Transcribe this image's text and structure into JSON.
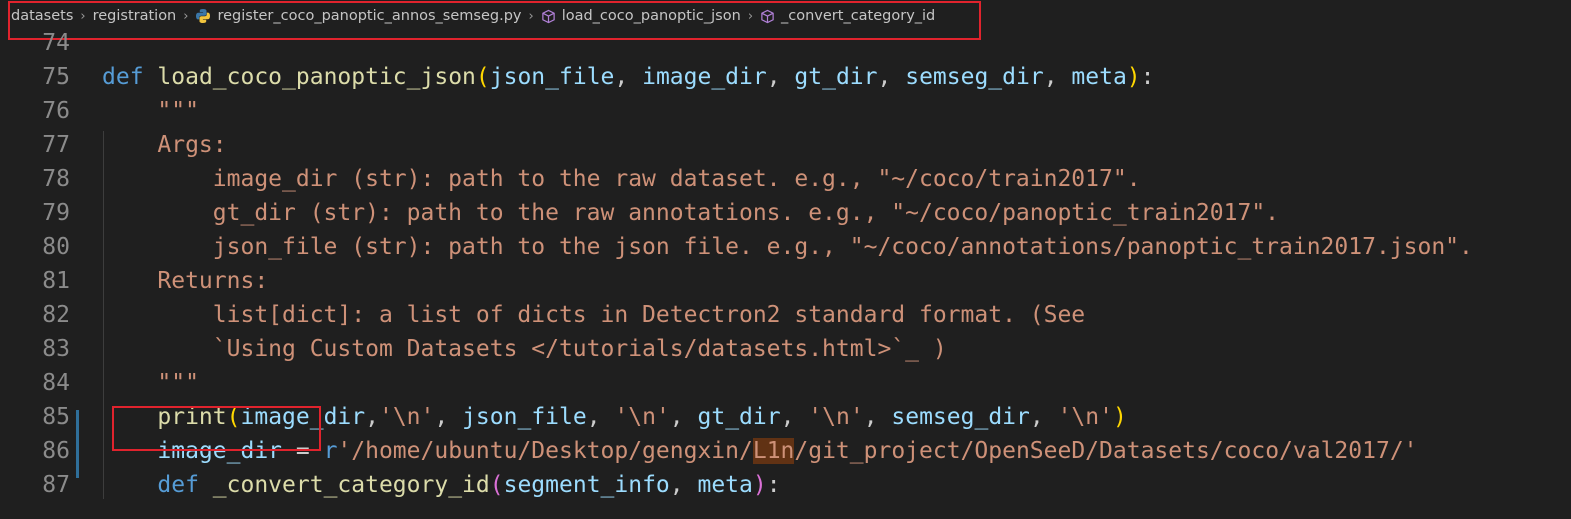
{
  "breadcrumb": {
    "items": [
      {
        "label": "datasets"
      },
      {
        "label": "registration"
      },
      {
        "label": "register_coco_panoptic_annos_semseg.py",
        "icon": "python-file-icon"
      },
      {
        "label": "load_coco_panoptic_json",
        "icon": "cube-symbol-icon"
      },
      {
        "label": "_convert_category_id",
        "icon": "cube-symbol-icon"
      }
    ]
  },
  "editor": {
    "lines": [
      {
        "num": "74",
        "text": ""
      },
      {
        "num": "75",
        "text": "def load_coco_panoptic_json(json_file, image_dir, gt_dir, semseg_dir, meta):"
      },
      {
        "num": "76",
        "text": "    \"\"\""
      },
      {
        "num": "77",
        "text": "    Args:"
      },
      {
        "num": "78",
        "text": "        image_dir (str): path to the raw dataset. e.g., \"~/coco/train2017\"."
      },
      {
        "num": "79",
        "text": "        gt_dir (str): path to the raw annotations. e.g., \"~/coco/panoptic_train2017\"."
      },
      {
        "num": "80",
        "text": "        json_file (str): path to the json file. e.g., \"~/coco/annotations/panoptic_train2017.json\"."
      },
      {
        "num": "81",
        "text": "    Returns:"
      },
      {
        "num": "82",
        "text": "        list[dict]: a list of dicts in Detectron2 standard format. (See"
      },
      {
        "num": "83",
        "text": "        `Using Custom Datasets </tutorials/datasets.html>`_ )"
      },
      {
        "num": "84",
        "text": "    \"\"\""
      },
      {
        "num": "85",
        "text": "    print(image_dir,'\\n', json_file, '\\n', gt_dir, '\\n', semseg_dir, '\\n')"
      },
      {
        "num": "86",
        "text": "    image_dir = r'/home/ubuntu/Desktop/gengxin/L1n/git_project/OpenSeeD/Datasets/coco/val2017/'"
      },
      {
        "num": "87",
        "text": "    def _convert_category_id(segment_info, meta):"
      }
    ]
  },
  "colors": {
    "keyword": "#569cd6",
    "function": "#dcdcaa",
    "parameter": "#9cdcfe",
    "string": "#ce9178",
    "highlight_box": "#e0232d"
  }
}
